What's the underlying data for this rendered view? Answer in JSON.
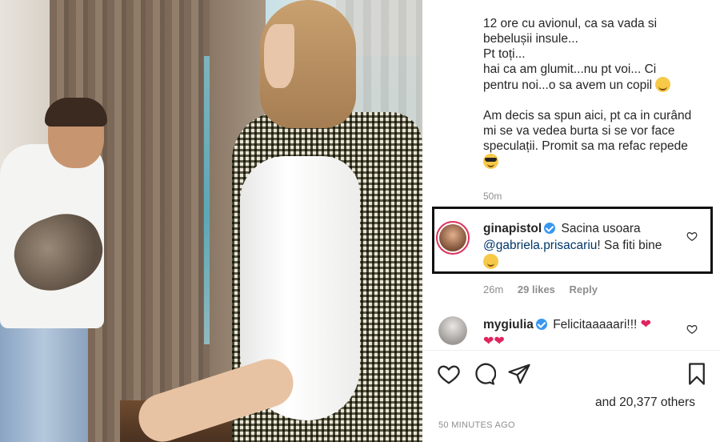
{
  "post": {
    "caption_lines": [
      "12 ore cu avionul, ca sa vada si",
      "bebelușii insule...",
      "Pt toți...",
      "hai ca am glumit...nu pt voi... Ci",
      "pentru noi...o sa avem un copil",
      "",
      "Am decis sa spun aici, pt ca in curând",
      "mi se va vedea burta si se vor face",
      "speculații. Promit sa ma refac repede"
    ],
    "caption_time": "50m",
    "time_ago": "50 MINUTES AGO",
    "likes_text": "and 20,377 others"
  },
  "comments": [
    {
      "username": "ginapistol",
      "text_before": "Sacina usoara",
      "mention": "@gabriela.prisacariu",
      "text_after": "! Sa fiti bine",
      "time": "26m",
      "likes": "29 likes",
      "reply": "Reply",
      "verified": true
    },
    {
      "username": "mygiulia",
      "text": "Felicitaaaaari!!!",
      "verified": true
    }
  ],
  "colors": {
    "highlight_border": "#111111",
    "verified": "#3897f0",
    "mention": "#00376b",
    "muted": "#8e8e8e",
    "heart_red": "#e0245e"
  },
  "icons": {
    "like": "heart-outline-icon",
    "comment": "speech-bubble-icon",
    "share": "paper-plane-icon",
    "save": "bookmark-icon"
  }
}
